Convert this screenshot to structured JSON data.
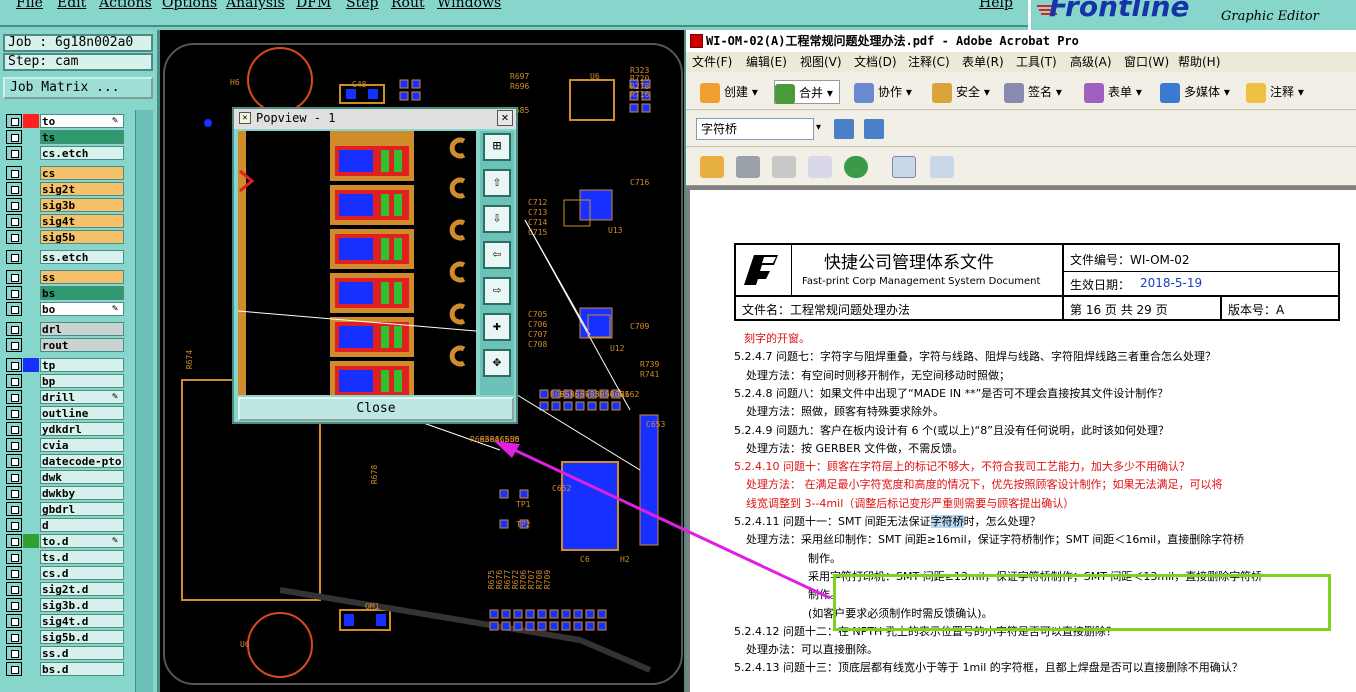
{
  "menubar": {
    "items": [
      "File",
      "Edit",
      "Actions",
      "Options",
      "Analysis",
      "DFM",
      "Step",
      "Rout",
      "Windows"
    ],
    "help": "Help"
  },
  "logo": {
    "brand": "Frontline",
    "subtitle": "Graphic Editor"
  },
  "left_panel": {
    "job": "Job : 6g18n002a0",
    "step": "Step: cam",
    "job_matrix": "Job Matrix ...",
    "layers": [
      {
        "name": "to",
        "color": "#ff2020",
        "style": "white",
        "flag": "✎"
      },
      {
        "name": "ts",
        "color": "",
        "style": "green",
        "flag": ""
      },
      {
        "name": "cs.etch",
        "color": "",
        "style": "plain",
        "flag": ""
      },
      {
        "name": "cs",
        "color": "",
        "style": "orange",
        "flag": ""
      },
      {
        "name": "sig2t",
        "color": "",
        "style": "orange",
        "flag": ""
      },
      {
        "name": "sig3b",
        "color": "",
        "style": "orange",
        "flag": ""
      },
      {
        "name": "sig4t",
        "color": "",
        "style": "orange",
        "flag": ""
      },
      {
        "name": "sig5b",
        "color": "",
        "style": "orange",
        "flag": ""
      },
      {
        "name": "ss.etch",
        "color": "",
        "style": "plain",
        "flag": ""
      },
      {
        "name": "ss",
        "color": "",
        "style": "orange",
        "flag": ""
      },
      {
        "name": "bs",
        "color": "",
        "style": "green",
        "flag": ""
      },
      {
        "name": "bo",
        "color": "",
        "style": "white",
        "flag": "✎"
      },
      {
        "name": "drl",
        "color": "",
        "style": "gray",
        "flag": ""
      },
      {
        "name": "rout",
        "color": "",
        "style": "gray",
        "flag": ""
      },
      {
        "name": "tp",
        "color": "#1530ff",
        "style": "plain",
        "flag": ""
      },
      {
        "name": "bp",
        "color": "",
        "style": "plain",
        "flag": ""
      },
      {
        "name": "drill",
        "color": "",
        "style": "plain",
        "flag": "✎"
      },
      {
        "name": "outline",
        "color": "",
        "style": "plain",
        "flag": ""
      },
      {
        "name": "ydkdrl",
        "color": "",
        "style": "plain",
        "flag": ""
      },
      {
        "name": "cvia",
        "color": "",
        "style": "plain",
        "flag": ""
      },
      {
        "name": "datecode-pto",
        "color": "",
        "style": "plain",
        "flag": ""
      },
      {
        "name": "dwk",
        "color": "",
        "style": "plain",
        "flag": ""
      },
      {
        "name": "dwkby",
        "color": "",
        "style": "plain",
        "flag": ""
      },
      {
        "name": "gbdrl",
        "color": "",
        "style": "plain",
        "flag": ""
      },
      {
        "name": "d",
        "color": "",
        "style": "plain",
        "flag": ""
      },
      {
        "name": "to.d",
        "color": "#30a030",
        "style": "plain",
        "flag": "✎"
      },
      {
        "name": "ts.d",
        "color": "",
        "style": "plain",
        "flag": ""
      },
      {
        "name": "cs.d",
        "color": "",
        "style": "plain",
        "flag": ""
      },
      {
        "name": "sig2t.d",
        "color": "",
        "style": "plain",
        "flag": ""
      },
      {
        "name": "sig3b.d",
        "color": "",
        "style": "plain",
        "flag": ""
      },
      {
        "name": "sig4t.d",
        "color": "",
        "style": "plain",
        "flag": ""
      },
      {
        "name": "sig5b.d",
        "color": "",
        "style": "plain",
        "flag": ""
      },
      {
        "name": "ss.d",
        "color": "",
        "style": "plain",
        "flag": ""
      },
      {
        "name": "bs.d",
        "color": "",
        "style": "plain",
        "flag": ""
      }
    ]
  },
  "pcb": {
    "labels": [
      "H6",
      "C48",
      "R697",
      "R696",
      "R685",
      "U6",
      "R323",
      "R720",
      "R278",
      "R716",
      "C712",
      "C713",
      "C714",
      "C715",
      "C716",
      "U13",
      "C705",
      "C706",
      "C707",
      "C708",
      "C709",
      "U12",
      "R739",
      "R741",
      "R655",
      "R656",
      "R657",
      "R658",
      "R659",
      "R660",
      "R661",
      "R662",
      "R663",
      "R664",
      "R665",
      "C650",
      "U5",
      "C653",
      "C652",
      "TP1",
      "TP2",
      "C6",
      "H2",
      "QM1",
      "U6",
      "R678",
      "R674",
      "R675",
      "R676",
      "R677",
      "R672",
      "R706",
      "R707",
      "R708",
      "R709"
    ]
  },
  "popview": {
    "title": "Popview - 1",
    "close_label": "Close"
  },
  "acrobat": {
    "title": "WI-OM-02(A)工程常规问题处理办法.pdf - Adobe Acrobat Pro",
    "menu": [
      "文件(F)",
      "编辑(E)",
      "视图(V)",
      "文档(D)",
      "注释(C)",
      "表单(R)",
      "工具(T)",
      "高级(A)",
      "窗口(W)",
      "帮助(H)"
    ],
    "toolbar": [
      "创建",
      "合并",
      "协作",
      "安全",
      "签名",
      "表单",
      "多媒体",
      "注释"
    ],
    "search_value": "字符桥"
  },
  "document": {
    "company_cn": "快捷公司管理体系文件",
    "company_en": "Fast-print Corp Management System Document",
    "doc_no": "文件编号：WI-OM-02",
    "eff_date_label": "生效日期：",
    "eff_date": "2018-5-19",
    "file_name": "文件名：工程常规问题处理办法",
    "page_info": "第 16 页 共 29 页",
    "version": "版本号：A",
    "lines": [
      {
        "text": "刻字的开窗。",
        "red": true
      },
      {
        "text": "5.2.4.7 问题七：字符字与阻焊重叠，字符与线路、阻焊与线路、字符阻焊线路三者重合怎么处理？",
        "red": false
      },
      {
        "text": "处理方法：有空间时则移开制作，无空间移动时照做；",
        "red": false
      },
      {
        "text": "5.2.4.8 问题八：如果文件中出现了“MADE IN **”是否可不理会直接按其文件设计制作？",
        "red": false
      },
      {
        "text": "处理方法：照做，顾客有特殊要求除外。",
        "red": false
      },
      {
        "text": "5.2.4.9 问题九：客户在板内设计有 6 个(或以上)“8”且没有任何说明，此时该如何处理？",
        "red": false
      },
      {
        "text": "处理方法：按 GERBER 文件做，不需反馈。",
        "red": false
      },
      {
        "text": "5.2.4.10 问题十：顾客在字符层上的标记不够大，不符合我司工艺能力，加大多少不用确认？",
        "red": true
      },
      {
        "text": "处理方法： 在满足最小字符宽度和高度的情况下，优先按照顾客设计制作；如果无法满足，可以将",
        "red": true
      },
      {
        "text": "线宽调整到 3--4mil（调整后标记变形严重则需要与顾客提出确认）",
        "red": true
      },
      {
        "text": "5.2.4.11 问题十一：SMT 间距无法保证字符桥时，怎么处理？",
        "red": false
      },
      {
        "text": "处理方法：采用丝印制作：SMT 间距≥16mil，保证字符桥制作；SMT 间距＜16mil，直接删除字符桥",
        "red": false
      },
      {
        "text": "制作。",
        "red": false
      },
      {
        "text": "采用字符打印机：SMT 间距≥13mil，保证字符桥制作；SMT 间距＜13mil，直接删除字符桥",
        "red": false
      },
      {
        "text": "制作。",
        "red": false
      },
      {
        "text": "(如客户要求必须制作时需反馈确认)。",
        "red": false
      },
      {
        "text": "5.2.4.12 问题十二：在 NPTH 孔上的表示位置号的小字符是否可以直接删除？",
        "red": false
      },
      {
        "text": "处理办法：可以直接删除。",
        "red": false
      },
      {
        "text": "5.2.4.13 问题十三：顶底层都有线宽小于等于 1mil 的字符框，且都上焊盘是否可以直接删除不用确认？",
        "red": false
      }
    ]
  },
  "colors": {
    "teal_panel": "#87d6cc",
    "pcb_trace": "#d08b2a",
    "pad_blue": "#1530ff",
    "arrow": "#e020e0",
    "highlight_green": "#7ed321"
  }
}
